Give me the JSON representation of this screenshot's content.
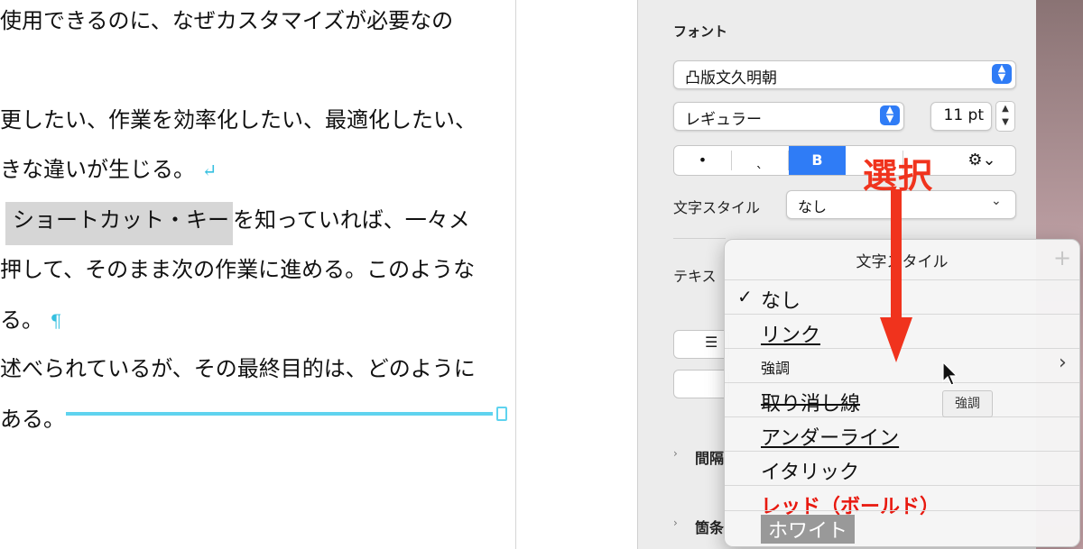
{
  "document": {
    "lines": [
      "使用できるのに、なぜカスタマイズが必要なの",
      "",
      "更したい、作業を効率化したい、最適化したい、",
      "きな違いが生じる。",
      "を知っていれば、一々メ",
      "押して、そのまま次の作業に進める。このような",
      "る。",
      "述べられているが、その最終目的は、どのように",
      "ある。"
    ],
    "highlight": "ショートカット・キー",
    "return_mark": "↵",
    "pilcrow": "¶"
  },
  "inspector": {
    "font_section_label": "フォント",
    "font_family": "凸版文久明朝",
    "font_style": "レギュラー",
    "font_size": "11 pt",
    "style_buttons": [
      "•",
      "ˎ",
      "B",
      "",
      "⚙⌄"
    ],
    "char_style_label": "文字スタイル",
    "char_style_value": "なし",
    "text_label": "テキス",
    "spacing_label": "間隔",
    "bullets_label": "箇条"
  },
  "menu": {
    "title": "文字スタイル",
    "add_label": "+",
    "items": [
      {
        "label": "なし",
        "checked": true
      },
      {
        "label": "リンク",
        "style": "underline"
      },
      {
        "label": "強調",
        "style": "small",
        "submenu": "›"
      },
      {
        "label": "取り消し線",
        "style": "strike"
      },
      {
        "label": "アンダーライン",
        "style": "underline"
      },
      {
        "label": "イタリック",
        "style": "plain"
      },
      {
        "label": "レッド（ボールド）",
        "style": "red-bold"
      },
      {
        "label": "ホワイト",
        "style": "white-on-gray"
      }
    ],
    "check_mark": "✓"
  },
  "annotation": {
    "text": "選択"
  },
  "tooltip": {
    "text": "強調"
  },
  "colors": {
    "accent": "#2f7cf6",
    "annotation_red": "#f0331d",
    "rule_cyan": "#5fd3ef"
  }
}
